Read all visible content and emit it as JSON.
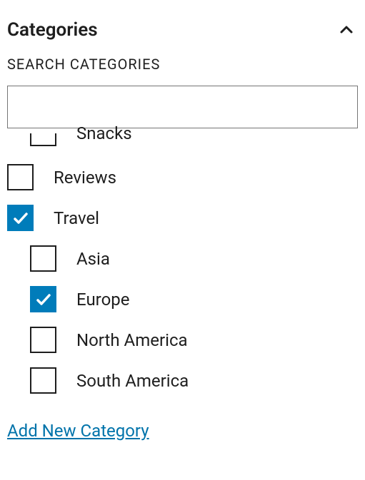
{
  "panel": {
    "title": "Categories"
  },
  "search": {
    "label": "SEARCH CATEGORIES",
    "value": ""
  },
  "categories": {
    "partial": {
      "label": "Snacks"
    },
    "reviews": {
      "label": "Reviews",
      "checked": false
    },
    "travel": {
      "label": "Travel",
      "checked": true
    },
    "asia": {
      "label": "Asia",
      "checked": false
    },
    "europe": {
      "label": "Europe",
      "checked": true
    },
    "north_america": {
      "label": "North America",
      "checked": false
    },
    "south_america": {
      "label": "South America",
      "checked": false
    }
  },
  "add_new": "Add New Category"
}
